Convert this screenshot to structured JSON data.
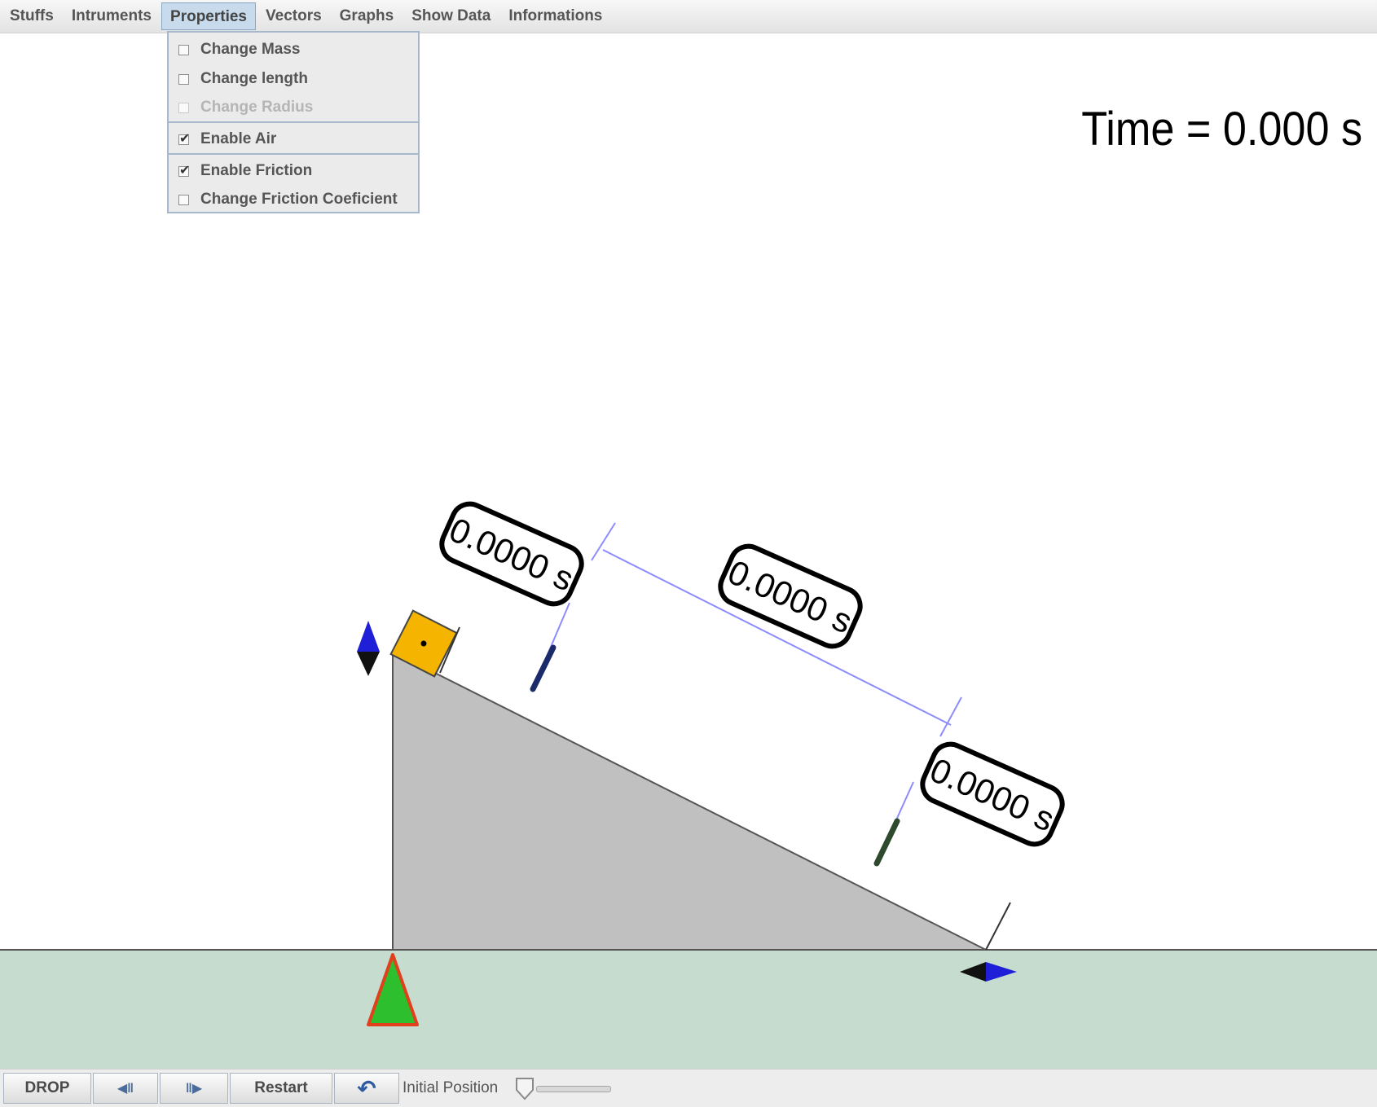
{
  "menu": {
    "items": [
      "Stuffs",
      "Intruments",
      "Properties",
      "Vectors",
      "Graphs",
      "Show Data",
      "Informations"
    ],
    "active": "Properties"
  },
  "properties_menu": {
    "change_mass": {
      "label": "Change Mass",
      "checked": false,
      "enabled": true
    },
    "change_length": {
      "label": "Change length",
      "checked": false,
      "enabled": true
    },
    "change_radius": {
      "label": "Change Radius",
      "checked": false,
      "enabled": false
    },
    "enable_air": {
      "label": "Enable Air",
      "checked": true,
      "enabled": true
    },
    "enable_friction": {
      "label": "Enable Friction",
      "checked": true,
      "enabled": true
    },
    "change_friction": {
      "label": "Change Friction Coeficient",
      "checked": false,
      "enabled": true
    }
  },
  "time_readout": "Time = 0.000 s",
  "timers": {
    "gate1": "0.0000 s",
    "between": "0.0000 s",
    "gate2": "0.0000 s"
  },
  "toolbar": {
    "drop": "DROP",
    "step_back": "◀‖",
    "step_forward": "‖▶",
    "restart": "Restart",
    "undo": "↶",
    "initial_position": "Initial Position",
    "initial_position_value": 0.0
  },
  "colors": {
    "ground": "#c6dccf",
    "ramp": "#c0c0c0",
    "block": "#f5b400",
    "pivot": "#2dbf2d",
    "pivot_outline": "#e0401c",
    "arrow_blue": "#1f1fd8",
    "guide_line": "#8c8cff"
  }
}
